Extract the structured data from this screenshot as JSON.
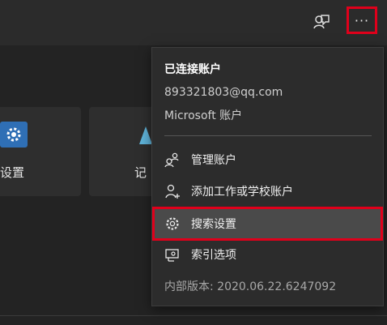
{
  "toolbar": {
    "more_label": "···"
  },
  "background": {
    "tile_labels": [
      "设置",
      "记"
    ]
  },
  "menu": {
    "heading": "已连接账户",
    "email": "893321803@qq.com",
    "account_type": "Microsoft 账户",
    "items": [
      {
        "label": "管理账户",
        "icon": "manage-accounts-icon"
      },
      {
        "label": "添加工作或学校账户",
        "icon": "add-account-icon"
      },
      {
        "label": "搜索设置",
        "icon": "gear-icon"
      },
      {
        "label": "索引选项",
        "icon": "index-options-icon"
      }
    ],
    "version": "内部版本: 2020.06.22.6247092"
  },
  "colors": {
    "highlight_border": "#e0001b",
    "menu_bg": "#2c2c2c",
    "selected_bg": "#4a4a4a"
  }
}
